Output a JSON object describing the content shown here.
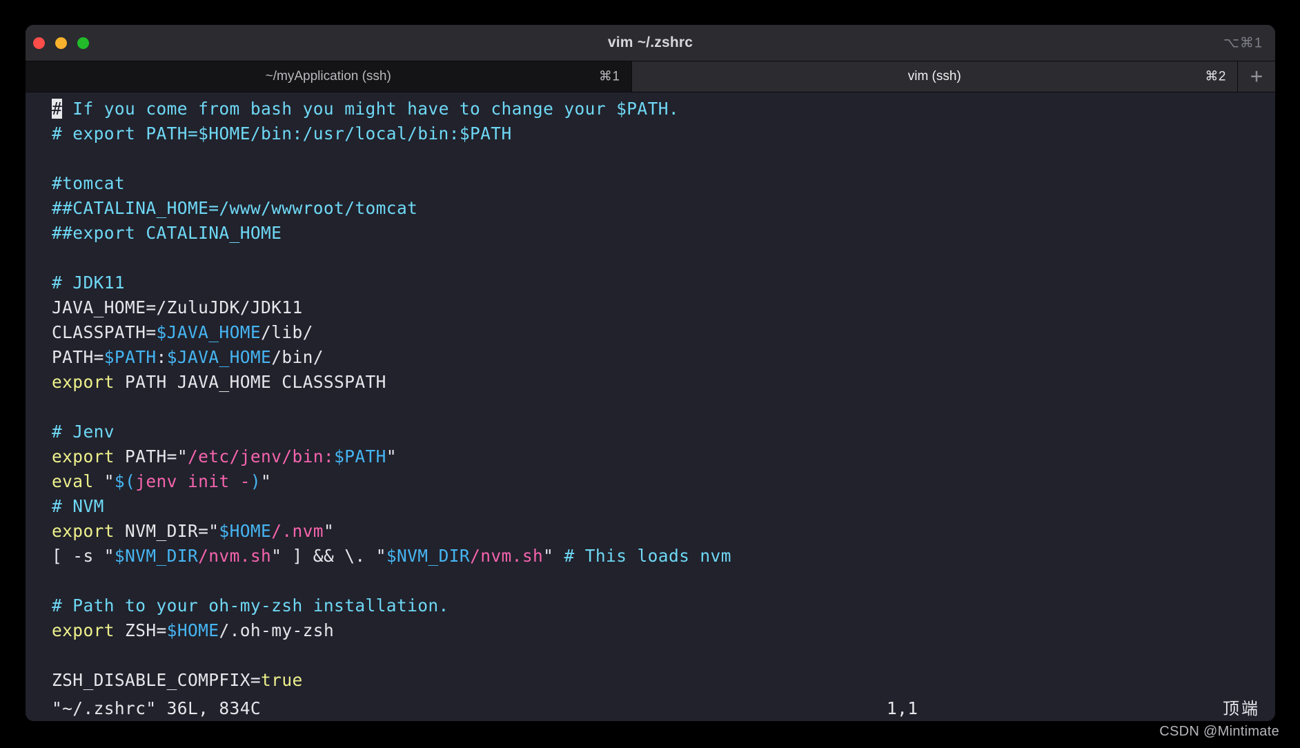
{
  "window": {
    "title": "vim ~/.zshrc",
    "shortcut": "⌥⌘1",
    "traffic_lights": [
      {
        "name": "close",
        "color": "#ff4d4a"
      },
      {
        "name": "minimize",
        "color": "#f8b22c"
      },
      {
        "name": "zoom",
        "color": "#22bb2a"
      }
    ]
  },
  "tabs": [
    {
      "label": "~/myApplication (ssh)",
      "shortcut": "⌘1",
      "active": false
    },
    {
      "label": "vim (ssh)",
      "shortcut": "⌘2",
      "active": true
    }
  ],
  "tab_add_label": "+",
  "editor": {
    "lines": [
      [
        {
          "t": "#",
          "c": "cursor"
        },
        {
          "t": " If you come from bash you might have to change your $PATH.",
          "c": "c-comment"
        }
      ],
      [
        {
          "t": "# export PATH=$HOME/bin:/usr/local/bin:$PATH",
          "c": "c-comment"
        }
      ],
      [],
      [
        {
          "t": "#tomcat",
          "c": "c-comment"
        }
      ],
      [
        {
          "t": "##CATALINA_HOME=/www/wwwroot/tomcat",
          "c": "c-comment"
        }
      ],
      [
        {
          "t": "##export CATALINA_HOME",
          "c": "c-comment"
        }
      ],
      [],
      [
        {
          "t": "# JDK11",
          "c": "c-comment"
        }
      ],
      [
        {
          "t": "JAVA_HOME=/ZuluJDK/JDK11",
          "c": "c-plain"
        }
      ],
      [
        {
          "t": "CLASSPATH=",
          "c": "c-plain"
        },
        {
          "t": "$JAVA_HOME",
          "c": "c-var"
        },
        {
          "t": "/lib/",
          "c": "c-plain"
        }
      ],
      [
        {
          "t": "PATH=",
          "c": "c-plain"
        },
        {
          "t": "$PATH",
          "c": "c-var"
        },
        {
          "t": ":",
          "c": "c-plain"
        },
        {
          "t": "$JAVA_HOME",
          "c": "c-var"
        },
        {
          "t": "/bin/",
          "c": "c-plain"
        }
      ],
      [
        {
          "t": "export",
          "c": "c-kw"
        },
        {
          "t": " PATH JAVA_HOME CLASSSPATH",
          "c": "c-plain"
        }
      ],
      [],
      [
        {
          "t": "# Jenv",
          "c": "c-comment"
        }
      ],
      [
        {
          "t": "export",
          "c": "c-kw"
        },
        {
          "t": " PATH=",
          "c": "c-plain"
        },
        {
          "t": "\"",
          "c": "c-punct"
        },
        {
          "t": "/etc/jenv/bin:",
          "c": "c-str"
        },
        {
          "t": "$PATH",
          "c": "c-var"
        },
        {
          "t": "\"",
          "c": "c-punct"
        }
      ],
      [
        {
          "t": "eval",
          "c": "c-kw"
        },
        {
          "t": " ",
          "c": "c-plain"
        },
        {
          "t": "\"",
          "c": "c-punct"
        },
        {
          "t": "$(",
          "c": "c-var"
        },
        {
          "t": "jenv init -",
          "c": "c-str"
        },
        {
          "t": ")",
          "c": "c-var"
        },
        {
          "t": "\"",
          "c": "c-punct"
        }
      ],
      [
        {
          "t": "# NVM",
          "c": "c-comment"
        }
      ],
      [
        {
          "t": "export",
          "c": "c-kw"
        },
        {
          "t": " NVM_DIR=",
          "c": "c-plain"
        },
        {
          "t": "\"",
          "c": "c-punct"
        },
        {
          "t": "$HOME",
          "c": "c-var"
        },
        {
          "t": "/.nvm",
          "c": "c-str"
        },
        {
          "t": "\"",
          "c": "c-punct"
        }
      ],
      [
        {
          "t": "[ -s ",
          "c": "c-plain"
        },
        {
          "t": "\"",
          "c": "c-punct"
        },
        {
          "t": "$NVM_DIR",
          "c": "c-var"
        },
        {
          "t": "/nvm.sh",
          "c": "c-str"
        },
        {
          "t": "\"",
          "c": "c-punct"
        },
        {
          "t": " ] && \\. ",
          "c": "c-plain"
        },
        {
          "t": "\"",
          "c": "c-punct"
        },
        {
          "t": "$NVM_DIR",
          "c": "c-var"
        },
        {
          "t": "/nvm.sh",
          "c": "c-str"
        },
        {
          "t": "\"",
          "c": "c-punct"
        },
        {
          "t": " ",
          "c": "c-plain"
        },
        {
          "t": "# This loads nvm",
          "c": "c-comment"
        }
      ],
      [],
      [
        {
          "t": "# Path to your oh-my-zsh installation.",
          "c": "c-comment"
        }
      ],
      [
        {
          "t": "export",
          "c": "c-kw"
        },
        {
          "t": " ZSH=",
          "c": "c-plain"
        },
        {
          "t": "$HOME",
          "c": "c-var"
        },
        {
          "t": "/.oh-my-zsh",
          "c": "c-plain"
        }
      ],
      [],
      [
        {
          "t": "ZSH_DISABLE_COMPFIX=",
          "c": "c-plain"
        },
        {
          "t": "true",
          "c": "c-kw"
        }
      ]
    ]
  },
  "statusline": {
    "file_info": "\"~/.zshrc\" 36L, 834C",
    "cursor_position": "1,1",
    "state": "顶端"
  },
  "watermark": "CSDN @Mintimate"
}
